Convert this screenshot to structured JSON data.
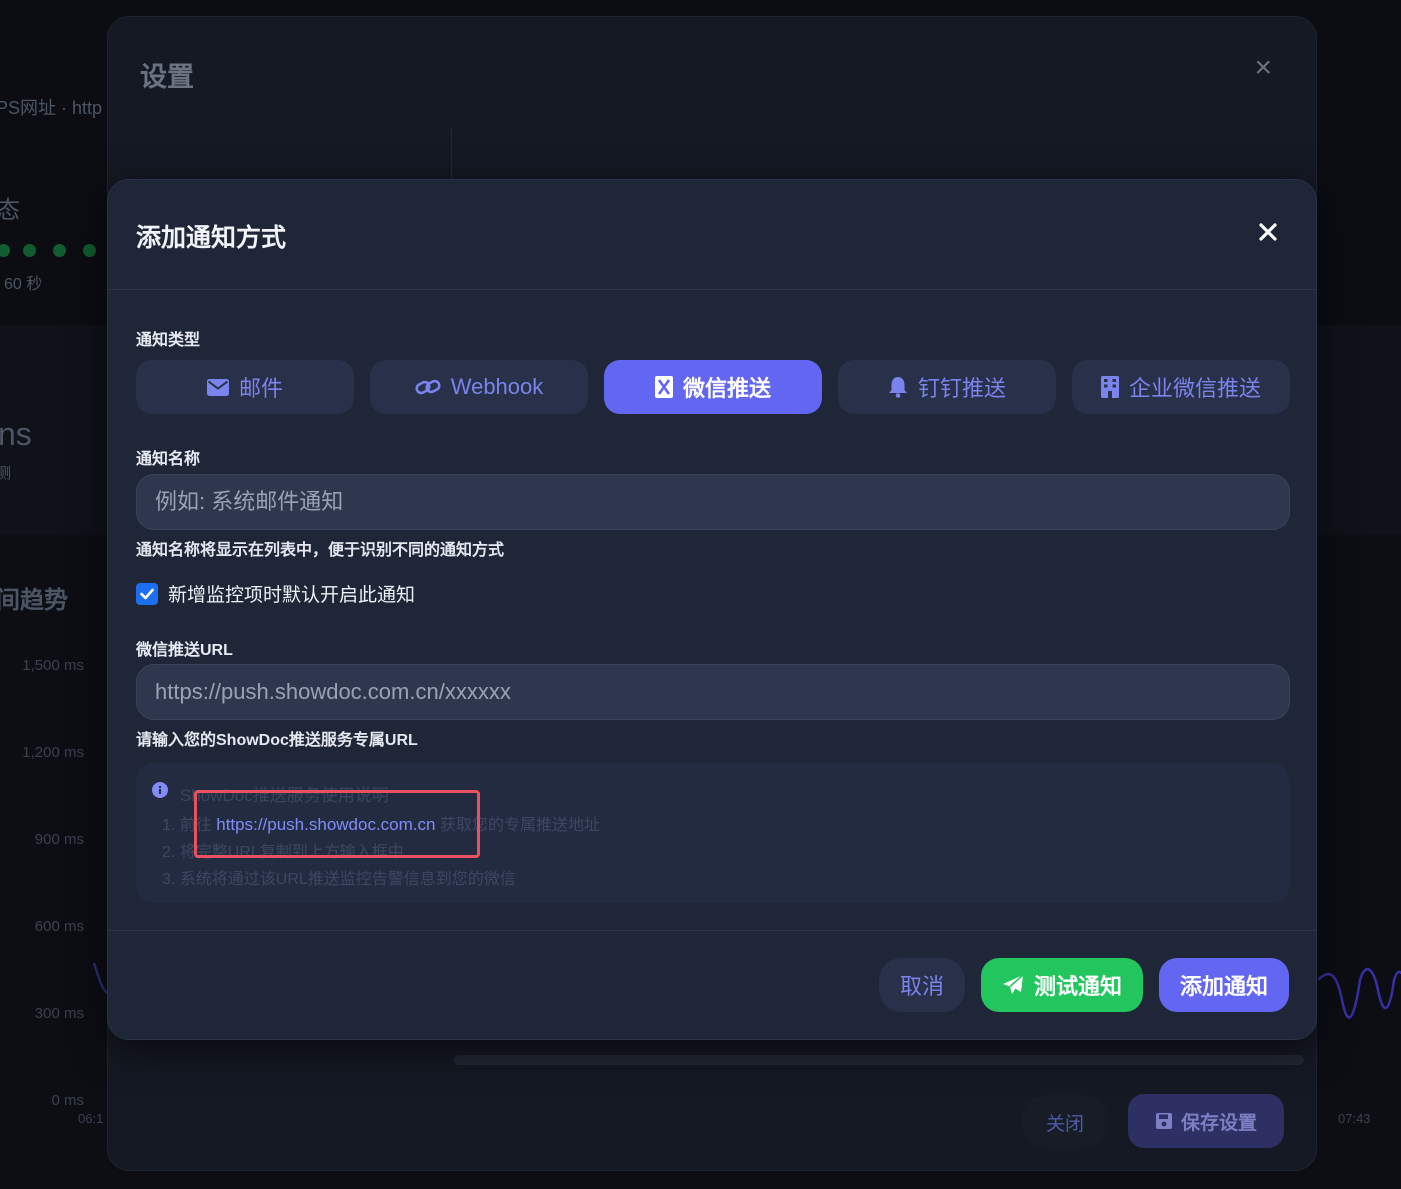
{
  "background": {
    "url_fragment": "PS网址 · http",
    "status_heading": "态",
    "interval": "60 秒",
    "ms_fragment": "ns",
    "detect_fragment": "测",
    "trend_heading": "间趋势",
    "y_axis_labels": [
      "1,500 ms",
      "1,200 ms",
      "900 ms",
      "600 ms",
      "300 ms",
      "0 ms"
    ],
    "x_axis_labels": [
      "06:1",
      "07:43"
    ]
  },
  "settings_modal": {
    "title": "设置",
    "close_icon": "×",
    "cancel_label": "关闭",
    "save_label": "保存设置"
  },
  "add_modal": {
    "title": "添加通知方式",
    "type_label": "通知类型",
    "types": [
      {
        "label": "邮件",
        "icon": "envelope-icon",
        "active": false
      },
      {
        "label": "Webhook",
        "icon": "link-icon",
        "active": false
      },
      {
        "label": "微信推送",
        "icon": "wechat-icon",
        "active": true
      },
      {
        "label": "钉钉推送",
        "icon": "bell-icon",
        "active": false
      },
      {
        "label": "企业微信推送",
        "icon": "building-icon",
        "active": false
      }
    ],
    "name_label": "通知名称",
    "name_placeholder": "例如: 系统邮件通知",
    "name_hint": "通知名称将显示在列表中，便于识别不同的通知方式",
    "default_enable_label": "新增监控项时默认开启此通知",
    "default_enable_checked": true,
    "url_label": "微信推送URL",
    "url_placeholder": "https://push.showdoc.com.cn/xxxxxx",
    "url_hint": "请输入您的ShowDoc推送服务专属URL",
    "info": {
      "title": "ShowDoc推送服务使用说明",
      "step1_prefix": "1. 前往",
      "step1_link": "https://push.showdoc.com.cn",
      "step1_suffix": "获取您的专属推送地址",
      "step2": "2. 将完整URL复制到上方输入框中",
      "step3": "3. 系统将通过该URL推送监控告警信息到您的微信"
    },
    "cancel_label": "取消",
    "test_label": "测试通知",
    "add_label": "添加通知",
    "colors": {
      "accent": "#6366f1",
      "success": "#22c55e",
      "highlight": "#e8525f"
    }
  }
}
